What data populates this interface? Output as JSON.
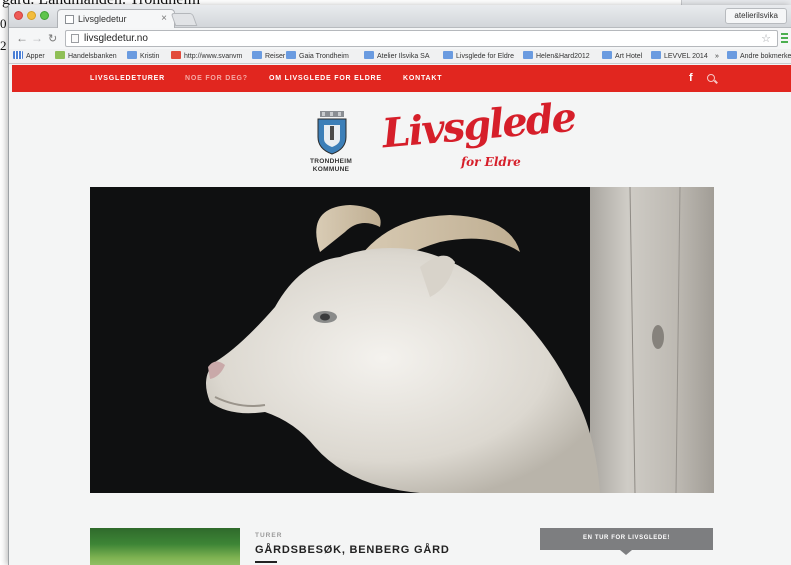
{
  "background_document": {
    "line1": "gård. Landmanden. Trondheim",
    "line2": "0",
    "line3": "2"
  },
  "browser": {
    "tab_title": "Livsgledetur",
    "tab_close": "×",
    "user": "atelierilsvika",
    "url": "livsgledetur.no",
    "bookmarks": [
      {
        "label": "Apper",
        "icon": "apps-grid-icon"
      },
      {
        "label": "Handelsbanken",
        "icon": "bank-icon"
      },
      {
        "label": "Kristin",
        "icon": "folder-icon"
      },
      {
        "label": "http://www.svanvm",
        "icon": "page-icon"
      },
      {
        "label": "Reiser",
        "icon": "folder-icon"
      },
      {
        "label": "Gaia Trondheim",
        "icon": "folder-icon"
      },
      {
        "label": "Atelier Ilsvika SA",
        "icon": "folder-icon"
      },
      {
        "label": "Livsglede for Eldre",
        "icon": "folder-icon"
      },
      {
        "label": "Helen&Hard2012",
        "icon": "folder-icon"
      },
      {
        "label": "Art Hotel",
        "icon": "folder-icon"
      },
      {
        "label": "LEVVEL 2014",
        "icon": "folder-icon"
      },
      {
        "label": "»",
        "icon": ""
      },
      {
        "label": "Andre bokmerker",
        "icon": "folder-icon"
      }
    ]
  },
  "site": {
    "nav": [
      {
        "label": "LIVSGLEDETURER",
        "active": true
      },
      {
        "label": "NOE FOR DEG?",
        "active": false
      },
      {
        "label": "OM LIVSGLEDE FOR ELDRE",
        "active": true
      },
      {
        "label": "KONTAKT",
        "active": true
      }
    ],
    "facebook": "f",
    "kommune_line1": "TRONDHEIM",
    "kommune_line2": "KOMMUNE",
    "logo_main": "Livsglede",
    "logo_sub": "for Eldre",
    "card": {
      "category": "TURER",
      "title": "GÅRDSBESØK, BENBERG GÅRD"
    },
    "sidebar_button": "EN TUR FOR LIVSGLEDE!"
  },
  "colors": {
    "brand_red": "#e1261f",
    "logo_red": "#d61f2a"
  }
}
